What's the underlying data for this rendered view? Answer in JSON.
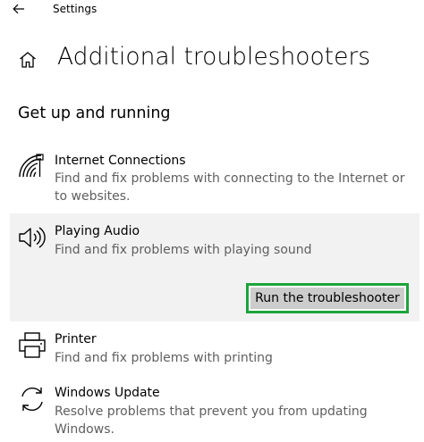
{
  "window": {
    "app_title": "Settings",
    "back_icon": "arrow-left-icon"
  },
  "header": {
    "home_icon": "home-icon",
    "title": "Additional troubleshooters"
  },
  "section": {
    "heading": "Get up and running"
  },
  "troubleshooters": [
    {
      "icon": "wifi-network-icon",
      "label": "Internet Connections",
      "description": "Find and fix problems with connecting to the Internet or to websites.",
      "selected": false
    },
    {
      "icon": "speaker-icon",
      "label": "Playing Audio",
      "description": "Find and fix problems with playing sound",
      "selected": true,
      "action_label": "Run the troubleshooter"
    },
    {
      "icon": "printer-icon",
      "label": "Printer",
      "description": "Find and fix problems with printing",
      "selected": false
    },
    {
      "icon": "refresh-icon",
      "label": "Windows Update",
      "description": "Resolve problems that prevent you from updating Windows.",
      "selected": false
    }
  ],
  "colors": {
    "selected_background": "#f2f2f2",
    "button_background": "#cccccc",
    "highlight_border": "#1da33b",
    "description_text": "#5f5f5f"
  }
}
